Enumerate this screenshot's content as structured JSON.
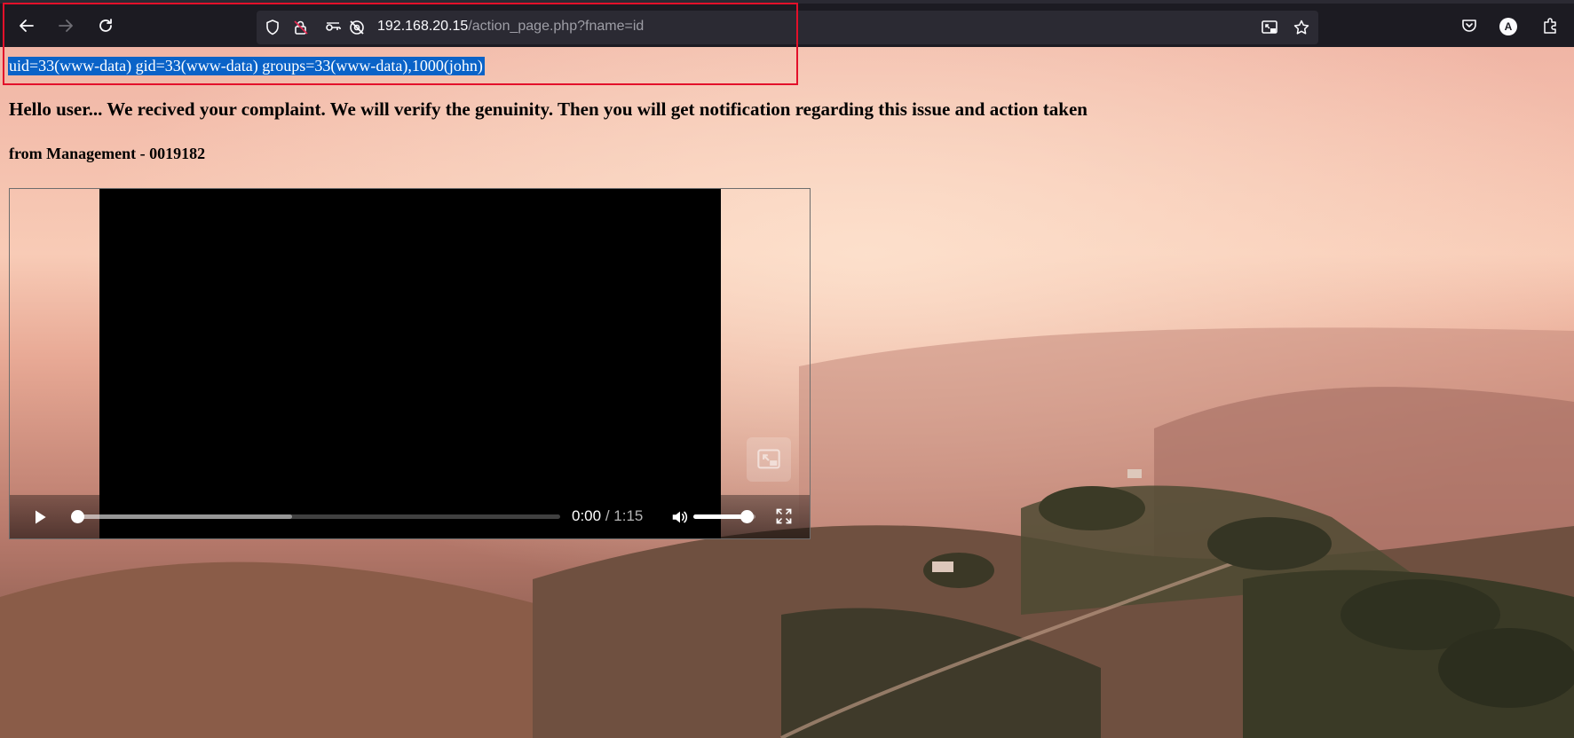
{
  "browser": {
    "url_host": "192.168.20.15",
    "url_path": "/action_page.php?fname=id",
    "account_initial": "A"
  },
  "page": {
    "command_output": "uid=33(www-data) gid=33(www-data) groups=33(www-data),1000(john)",
    "heading": "Hello user... We recived your complaint. We will verify the genuinity. Then you will get notification regarding this issue and action taken",
    "subheading": "from Management - 0019182"
  },
  "video": {
    "current_time": "0:00",
    "separator": " / ",
    "duration": "1:15",
    "buffered_fraction": 0.45,
    "progress_fraction": 0.0,
    "volume_fraction": 0.85
  },
  "icons": {
    "back": "arrow-left-icon",
    "forward": "arrow-right-icon",
    "reload": "reload-icon",
    "shield": "shield-icon",
    "permissions": "permissions-icon",
    "key": "key-icon",
    "tracking": "tracking-off-icon",
    "pip": "picture-in-picture-icon",
    "bookmark": "star-icon",
    "pocket": "pocket-icon",
    "extensions": "puzzle-icon"
  },
  "colors": {
    "selection": "#0a63c8",
    "annotation_box": "#e3102a",
    "chrome_bg": "#1c1b22",
    "urlbar_bg": "#2b2a33"
  }
}
